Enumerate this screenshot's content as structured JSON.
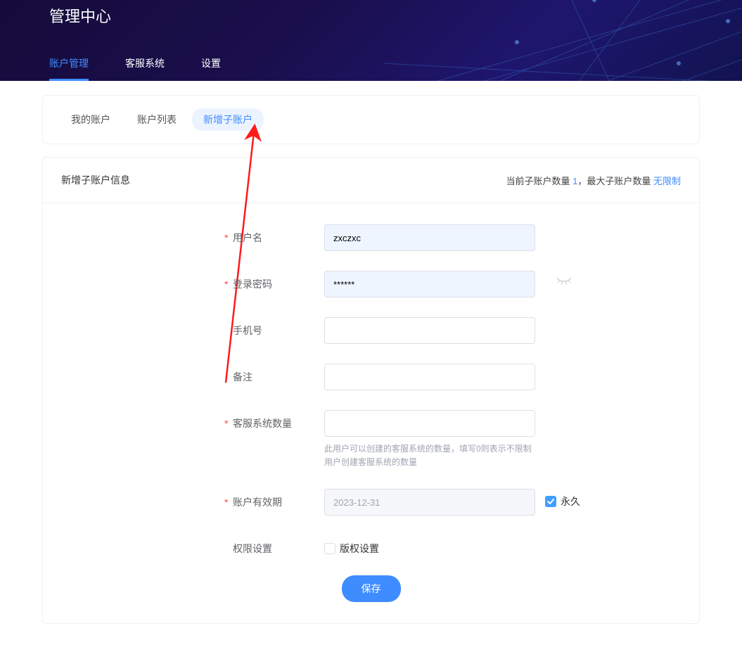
{
  "header": {
    "title": "管理中心",
    "tabs": [
      {
        "label": "账户管理",
        "active": true
      },
      {
        "label": "客服系统",
        "active": false
      },
      {
        "label": "设置",
        "active": false
      }
    ]
  },
  "subtabs": [
    {
      "label": "我的账户",
      "active": false
    },
    {
      "label": "账户列表",
      "active": false
    },
    {
      "label": "新增子账户",
      "active": true
    }
  ],
  "card": {
    "title": "新增子账户信息",
    "stats_prefix": "当前子账户数量 ",
    "stats_count": "1",
    "stats_mid": "，最大子账户数量 ",
    "stats_max": "无限制"
  },
  "form": {
    "username": {
      "label": "用户名",
      "value": "zxczxc",
      "required": true
    },
    "password": {
      "label": "登录密码",
      "value": "******",
      "required": true
    },
    "phone": {
      "label": "手机号",
      "value": "",
      "required": false
    },
    "remark": {
      "label": "备注",
      "value": "",
      "required": false
    },
    "kf_count": {
      "label": "客服系统数量",
      "value": "",
      "required": true,
      "help1": "此用户可以创建的客服系统的数量，填写0则表示不限制",
      "help2": "用户创建客服系统的数量"
    },
    "expire": {
      "label": "账户有效期",
      "value": "2023-12-31",
      "required": true,
      "forever_label": "永久",
      "forever_checked": true
    },
    "perm": {
      "label": "权限设置",
      "checkbox_label": "版权设置",
      "checked": false
    }
  },
  "actions": {
    "save": "保存"
  }
}
